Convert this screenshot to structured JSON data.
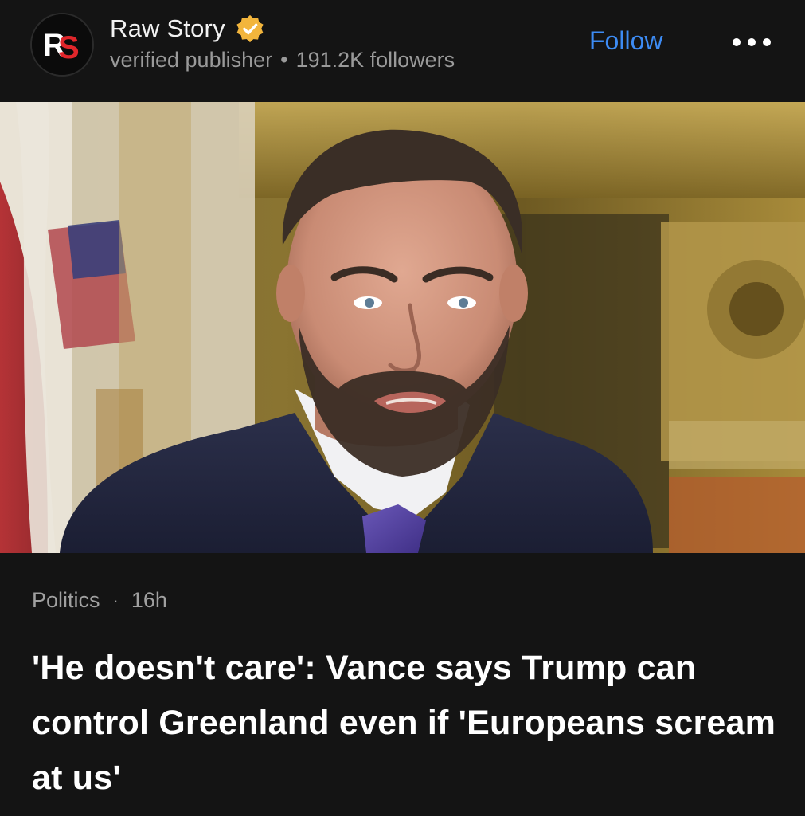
{
  "publisher": {
    "name": "Raw Story",
    "logo_text": "RS",
    "meta_label": "verified publisher",
    "separator": "•",
    "followers": "191.2K followers",
    "verified_icon": "verified-badge-icon"
  },
  "actions": {
    "follow_label": "Follow",
    "more_icon": "more-horizontal-icon"
  },
  "article": {
    "category": "Politics",
    "separator": "·",
    "age": "16h",
    "headline": "'He doesn't care': Vance says Trump can control Greenland even if 'Europeans scream at us'"
  },
  "colors": {
    "background": "#141414",
    "accent": "#3d8bf3",
    "verified": "#f2b53c",
    "logo_red": "#e0262b"
  }
}
